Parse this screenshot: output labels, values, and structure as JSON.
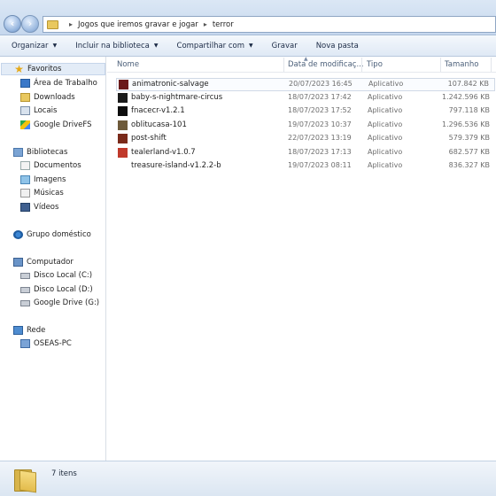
{
  "address": {
    "segments": [
      "Jogos que iremos gravar e jogar",
      "terror"
    ]
  },
  "toolbar": {
    "organize": "Organizar",
    "include": "Incluir na biblioteca",
    "share": "Compartilhar com",
    "burn": "Gravar",
    "new_folder": "Nova pasta"
  },
  "sidebar": {
    "favorites": {
      "label": "Favoritos",
      "items": [
        "Área de Trabalho",
        "Downloads",
        "Locais",
        "Google DriveFS"
      ]
    },
    "libraries": {
      "label": "Bibliotecas",
      "items": [
        "Documentos",
        "Imagens",
        "Músicas",
        "Vídeos"
      ]
    },
    "homegroup": {
      "label": "Grupo doméstico"
    },
    "computer": {
      "label": "Computador",
      "items": [
        "Disco Local (C:)",
        "Disco Local (D:)",
        "Google Drive (G:)"
      ]
    },
    "network": {
      "label": "Rede",
      "items": [
        "OSEAS-PC"
      ]
    }
  },
  "columns": {
    "name": "Nome",
    "date": "Data de modificaç...",
    "type": "Tipo",
    "size": "Tamanho"
  },
  "files": [
    {
      "name": "animatronic-salvage",
      "date": "20/07/2023 16:45",
      "type": "Aplicativo",
      "size": "107.842 KB",
      "icon_color": "#6b1a1a"
    },
    {
      "name": "baby-s-nightmare-circus",
      "date": "18/07/2023 17:42",
      "type": "Aplicativo",
      "size": "1.242.596 KB",
      "icon_color": "#1a1a1a"
    },
    {
      "name": "fnacecr-v1.2.1",
      "date": "18/07/2023 17:52",
      "type": "Aplicativo",
      "size": "797.118 KB",
      "icon_color": "#0d0d0d"
    },
    {
      "name": "oblitucasa-101",
      "date": "19/07/2023 10:37",
      "type": "Aplicativo",
      "size": "1.296.536 KB",
      "icon_color": "#6e5a3a"
    },
    {
      "name": "post-shift",
      "date": "22/07/2023 13:19",
      "type": "Aplicativo",
      "size": "579.379 KB",
      "icon_color": "#7a2a1a"
    },
    {
      "name": "tealerland-v1.0.7",
      "date": "18/07/2023 17:13",
      "type": "Aplicativo",
      "size": "682.577 KB",
      "icon_color": "#c0392b"
    },
    {
      "name": "treasure-island-v1.2.2-b",
      "date": "19/07/2023 08:11",
      "type": "Aplicativo",
      "size": "836.327 KB",
      "icon_color": "#ffffff"
    }
  ],
  "status": {
    "count": "7 itens"
  }
}
